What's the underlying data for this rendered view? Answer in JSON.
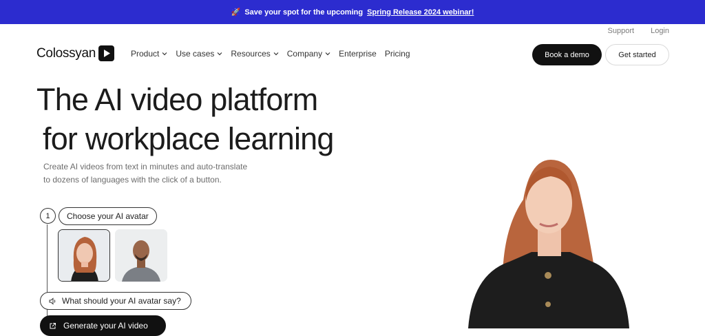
{
  "banner": {
    "prefix": "Save your spot for the upcoming",
    "link": "Spring Release 2024 webinar!",
    "icon": "rocket-icon",
    "color": "#2c2ccf"
  },
  "utility": {
    "support": "Support",
    "login": "Login"
  },
  "logo": {
    "text": "Colossyan",
    "icon": "play-mark-icon"
  },
  "nav": {
    "items": [
      {
        "label": "Product",
        "has_dropdown": true
      },
      {
        "label": "Use cases",
        "has_dropdown": true
      },
      {
        "label": "Resources",
        "has_dropdown": true
      },
      {
        "label": "Company",
        "has_dropdown": true
      },
      {
        "label": "Enterprise",
        "has_dropdown": false
      },
      {
        "label": "Pricing",
        "has_dropdown": false
      }
    ]
  },
  "cta": {
    "book_demo": "Book a demo",
    "get_started": "Get started"
  },
  "hero": {
    "title_line1": "The AI video platform",
    "title_line2": "for workplace learning",
    "subtitle_line1": "Create AI videos from text in minutes and auto-translate",
    "subtitle_line2": "to dozens of languages with the click of a button."
  },
  "steps": {
    "number": "1",
    "choose_label": "Choose your AI avatar",
    "say_label": "What should your AI avatar say?",
    "generate_label": "Generate your AI video",
    "avatars": [
      {
        "name": "female-avatar-option",
        "selected": true
      },
      {
        "name": "male-avatar-option",
        "selected": false
      }
    ]
  }
}
